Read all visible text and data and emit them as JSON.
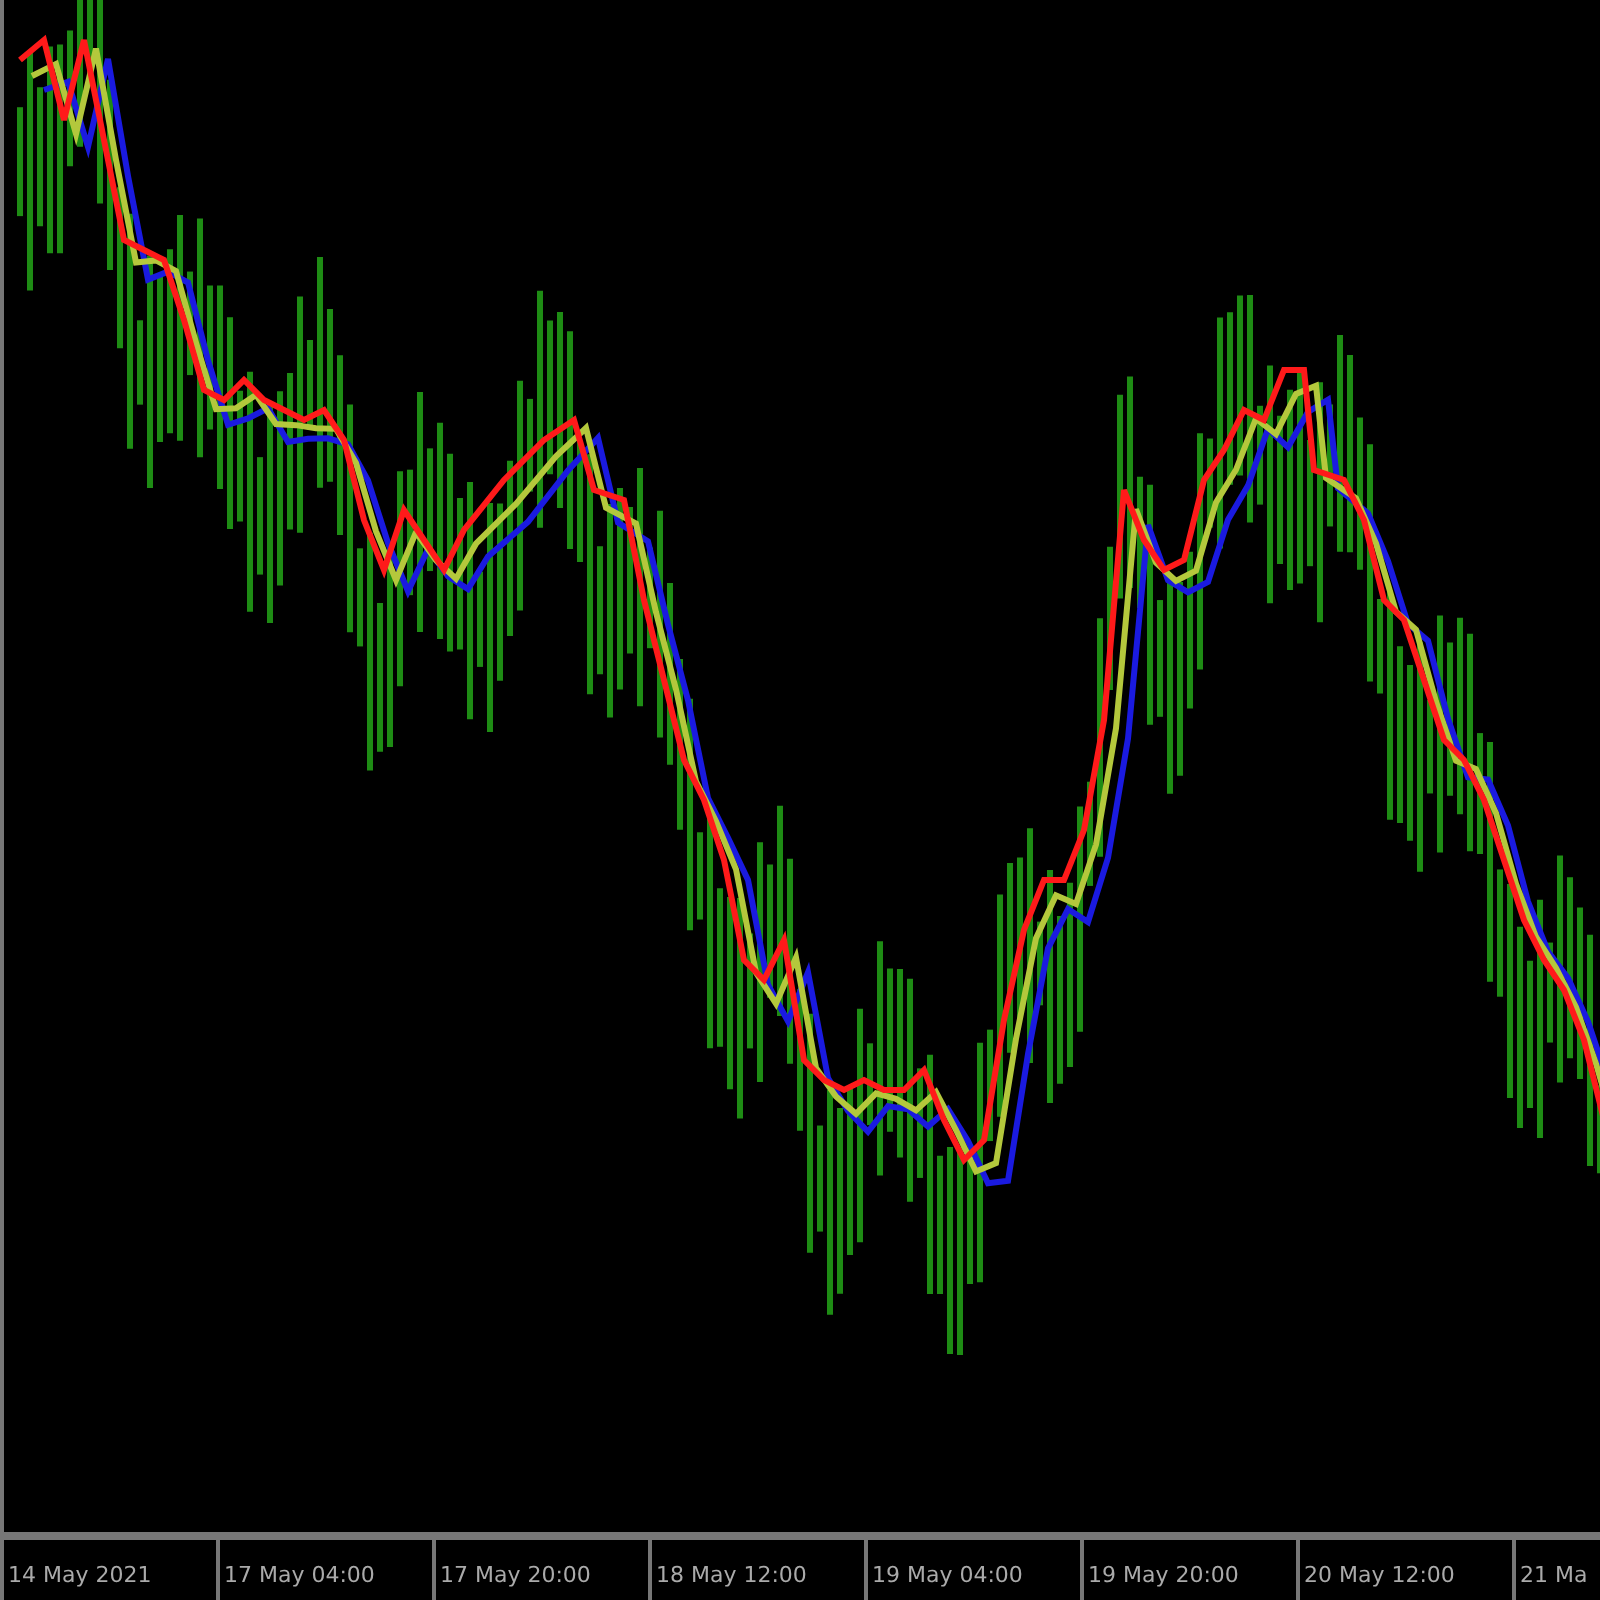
{
  "x_axis": {
    "labels": [
      "14 May 2021",
      "17 May 04:00",
      "17 May 20:00",
      "18 May 12:00",
      "19 May 04:00",
      "19 May 20:00",
      "20 May 12:00",
      "21 Ma"
    ]
  }
}
